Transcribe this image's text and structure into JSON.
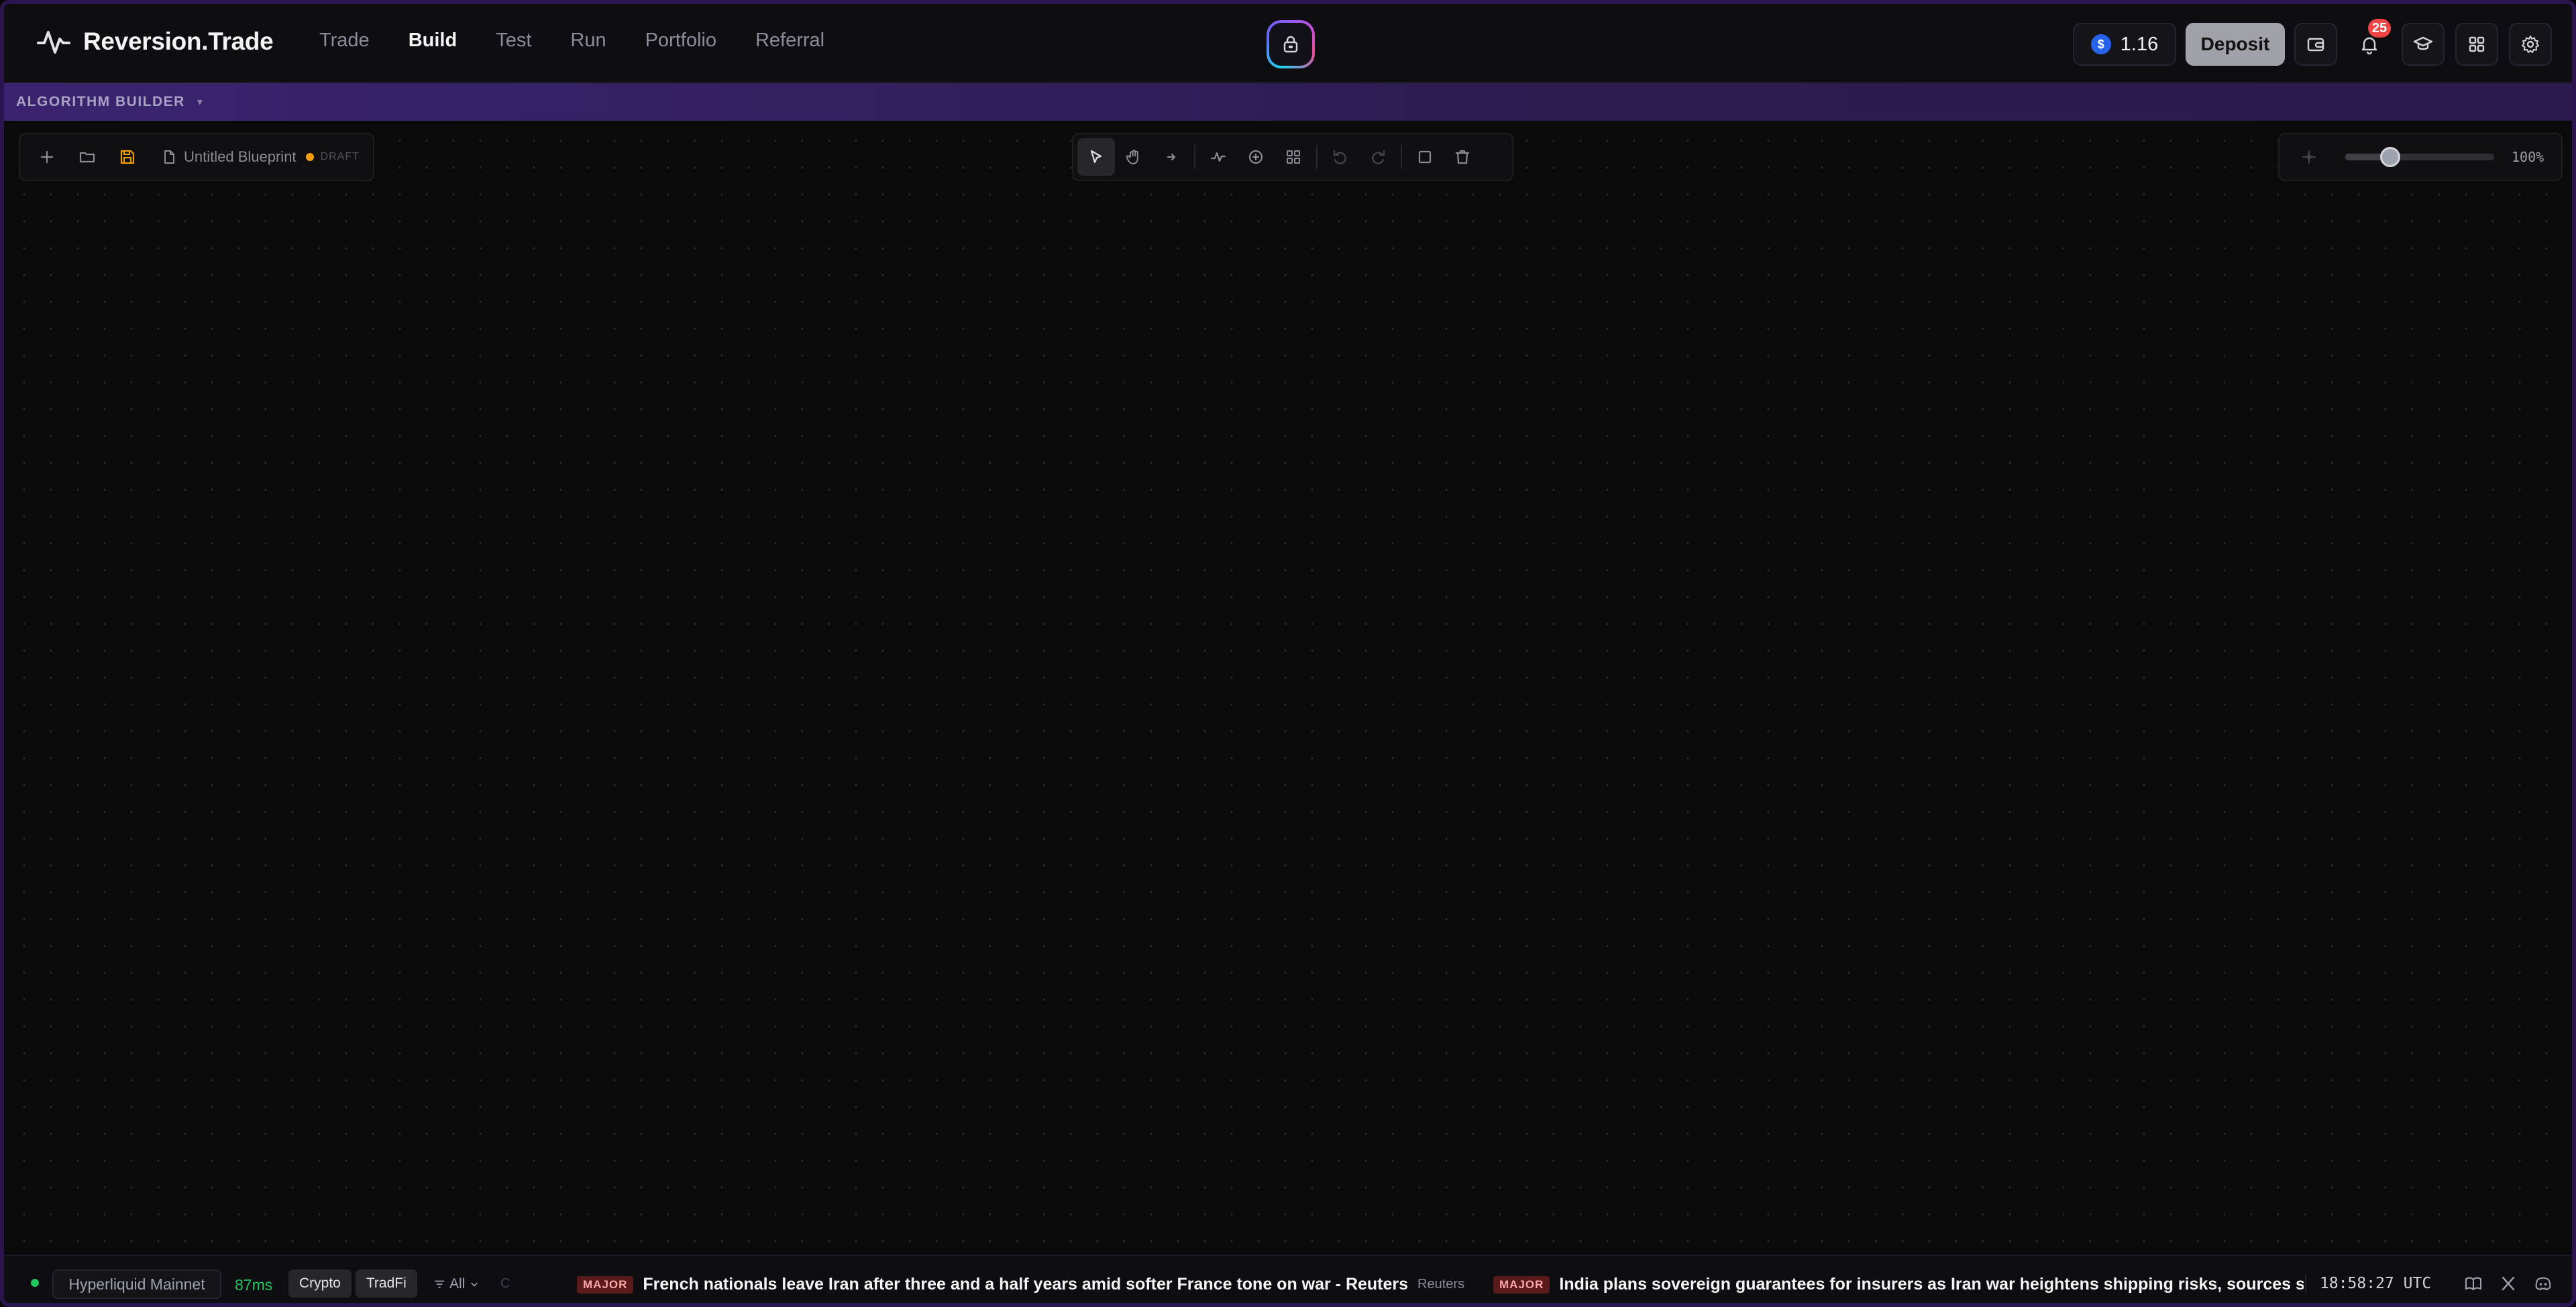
{
  "app": {
    "name": "Reversion.Trade"
  },
  "nav": {
    "items": [
      {
        "label": "Trade",
        "active": false
      },
      {
        "label": "Build",
        "active": true
      },
      {
        "label": "Test",
        "active": false
      },
      {
        "label": "Run",
        "active": false
      },
      {
        "label": "Portfolio",
        "active": false
      },
      {
        "label": "Referral",
        "active": false
      }
    ]
  },
  "header": {
    "balance": "1.16",
    "deposit_label": "Deposit",
    "notification_count": "25",
    "icons": [
      "wallet-icon",
      "bell-icon",
      "graduation-cap-icon",
      "grid-icon",
      "gear-icon"
    ]
  },
  "section": {
    "title": "ALGORITHM BUILDER",
    "caret": "▾"
  },
  "file": {
    "name": "Untitled Blueprint",
    "status": "DRAFT"
  },
  "zoom": {
    "value_label": "100%",
    "level": 0.3
  },
  "footer": {
    "network": "Hyperliquid Mainnet",
    "latency": "87ms",
    "market_tabs": [
      "Crypto",
      "TradFi"
    ],
    "filter_label": "All",
    "ticker_fragment": "C",
    "news": [
      {
        "tag": "MAJOR",
        "headline": "French nationals leave Iran after three and a half years amid softer France tone on war - Reuters",
        "source": "Reuters"
      },
      {
        "tag": "MAJOR",
        "headline": "India plans sovereign guarantees for insurers as Iran war heightens shipping risks, sources say - R",
        "source": ""
      }
    ],
    "clock": "18:58:27 UTC"
  },
  "colors": {
    "accent_purple": "#3a2470",
    "status_green": "#22c55e",
    "badge_red": "#ef4444",
    "draft_amber": "#f59e0b"
  }
}
